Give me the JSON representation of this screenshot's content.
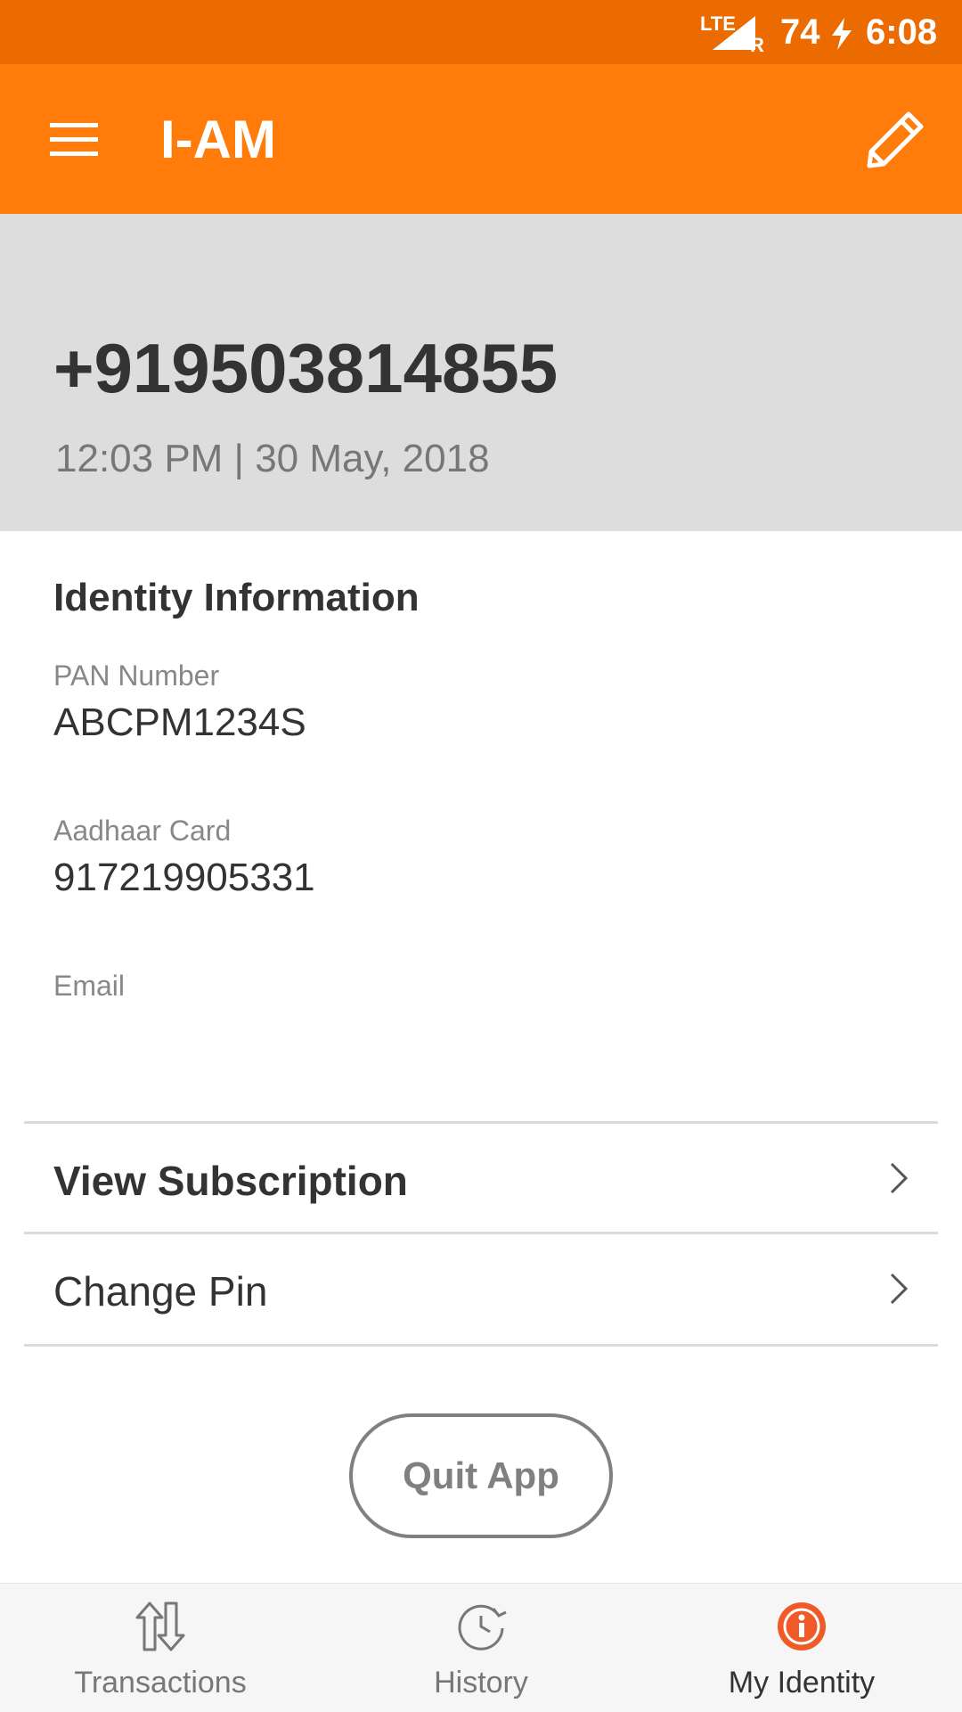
{
  "status_bar": {
    "network": "LTE",
    "roaming": "R",
    "battery": "74",
    "time": "6:08"
  },
  "app_bar": {
    "title": "I-AM",
    "menu_icon": "hamburger-menu-icon",
    "edit_icon": "pencil-icon"
  },
  "hero": {
    "phone": "+919503814855",
    "datetime": "12:03 PM | 30 May, 2018"
  },
  "identity": {
    "title": "Identity Information",
    "fields": [
      {
        "label": "PAN Number",
        "value": "ABCPM1234S"
      },
      {
        "label": "Aadhaar Card",
        "value": "917219905331"
      },
      {
        "label": "Email",
        "value": ""
      }
    ]
  },
  "menu": {
    "view_subscription": "View Subscription",
    "change_pin": "Change Pin"
  },
  "quit_button": "Quit App",
  "bottom_nav": [
    {
      "label": "Transactions",
      "icon": "up-down-arrows-icon"
    },
    {
      "label": "History",
      "icon": "history-clock-icon"
    },
    {
      "label": "My Identity",
      "icon": "identity-icon",
      "active": true
    }
  ],
  "colors": {
    "status_bar": "#EB6B00",
    "app_bar": "#FF7B0A",
    "hero_bg": "#DDDDDD",
    "accent": "#F05A28"
  }
}
